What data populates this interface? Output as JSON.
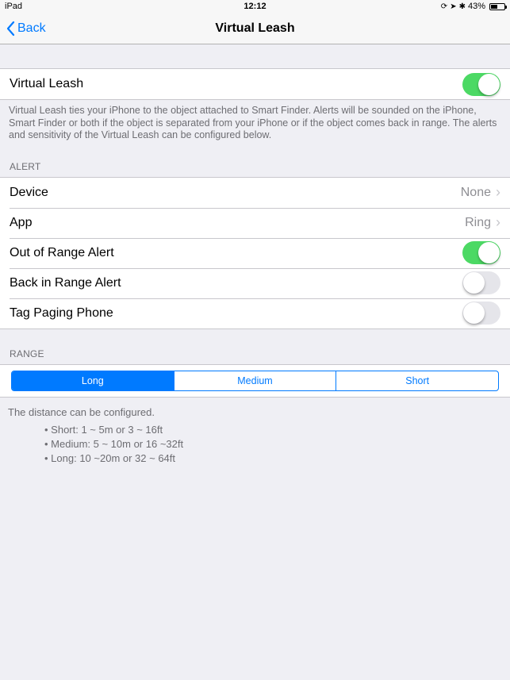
{
  "status": {
    "device": "iPad",
    "time": "12:12",
    "battery_pct": "43%"
  },
  "nav": {
    "back": "Back",
    "title": "Virtual Leash"
  },
  "main_toggle": {
    "label": "Virtual Leash",
    "on": true
  },
  "main_footer": "Virtual Leash ties your iPhone to the object attached to Smart Finder. Alerts will be sounded on the iPhone, Smart Finder or both if the object is separated from your iPhone or  if the object comes back in  range.  The alerts and sensitivity of the Virtual Leash can be configured below.",
  "alert": {
    "header": "ALERT",
    "device": {
      "label": "Device",
      "value": "None"
    },
    "app": {
      "label": "App",
      "value": "Ring"
    },
    "out_of_range": {
      "label": "Out of Range Alert",
      "on": true
    },
    "back_in_range": {
      "label": "Back in Range Alert",
      "on": false
    },
    "tag_paging": {
      "label": "Tag Paging Phone",
      "on": false
    }
  },
  "range": {
    "header": "RANGE",
    "options": {
      "long": "Long",
      "medium": "Medium",
      "short": "Short"
    },
    "selected": "long",
    "desc_intro": "The distance can be configured.",
    "desc_short": "Short: 1 ~ 5m or 3 ~ 16ft",
    "desc_medium": "Medium: 5 ~ 10m or 16 ~32ft",
    "desc_long": "Long: 10 ~20m or 32 ~ 64ft"
  }
}
